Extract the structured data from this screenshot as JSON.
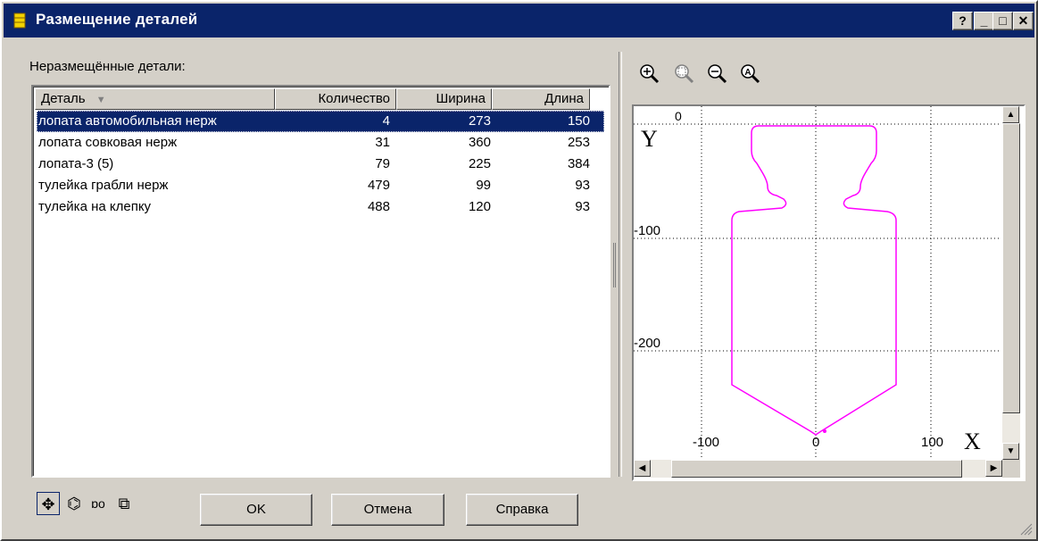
{
  "window": {
    "title": "Размещение деталей",
    "buttons": {
      "help": "?",
      "minimize": "_",
      "maximize": "□",
      "close": "✕"
    }
  },
  "left": {
    "label": "Неразмещённые детали:",
    "columns": [
      "Деталь",
      "Количество",
      "Ширина",
      "Длина"
    ],
    "rows": [
      {
        "name": "лопата автомобильная нерж",
        "qty": "4",
        "width": "273",
        "length": "150",
        "selected": true
      },
      {
        "name": "лопата совковая нерж",
        "qty": "31",
        "width": "360",
        "length": "253",
        "selected": false
      },
      {
        "name": "лопата-3 (5)",
        "qty": "79",
        "width": "225",
        "length": "384",
        "selected": false
      },
      {
        "name": "тулейка грабли нерж",
        "qty": "479",
        "width": "99",
        "length": "93",
        "selected": false
      },
      {
        "name": "тулейка на клепку",
        "qty": "488",
        "width": "120",
        "length": "93",
        "selected": false
      }
    ]
  },
  "preview": {
    "y_label": "Y",
    "x_label": "X",
    "y_ticks": [
      "0",
      "-100",
      "-200"
    ],
    "x_ticks": [
      "-100",
      "0",
      "100"
    ],
    "shape_color": "#ff00ff"
  },
  "zoom_icons": [
    "zoom-in-icon",
    "zoom-window-icon",
    "zoom-out-icon",
    "zoom-all-icon"
  ],
  "tools": [
    "move-icon",
    "rotate-icon",
    "mirror-icon",
    "array-icon"
  ],
  "buttons": {
    "ok": "OK",
    "cancel": "Отмена",
    "help": "Справка"
  }
}
